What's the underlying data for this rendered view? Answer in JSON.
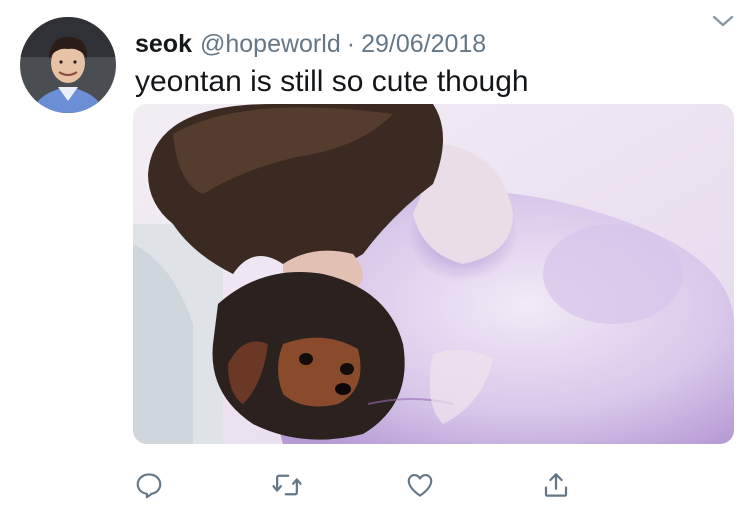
{
  "tweet": {
    "author_name": "seok",
    "handle": "@hopeworld",
    "separator": "·",
    "date": "29/06/2018",
    "text": "yeontan is still so cute though"
  },
  "icons": {
    "menu": "chevron-down-icon",
    "reply": "reply-icon",
    "retweet": "retweet-icon",
    "like": "heart-icon",
    "share": "share-icon"
  },
  "colors": {
    "text_primary": "#14171a",
    "text_secondary": "#657786",
    "icon": "#657786"
  }
}
